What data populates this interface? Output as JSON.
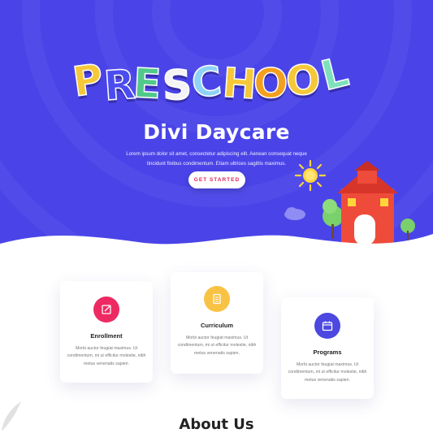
{
  "hero": {
    "logo_letters": [
      "P",
      "R",
      "E",
      "S",
      "C",
      "H",
      "O",
      "O",
      "L"
    ],
    "title": "Divi Daycare",
    "description": "Lorem ipsum dolor sit amet, consectetur adipiscing elit. Aenean consequat neque tincidunt finibus condimentum. Etiam ultrices sagittis maximus.",
    "cta_label": "GET STARTED"
  },
  "features": [
    {
      "title": "Enrollment",
      "text": "Morbi auctor feugiat maximus. Ut condimentum, mi ut efficitur molestie, nibh metus venenatis sapien.",
      "icon": "edit-icon",
      "color": "#ee2a62"
    },
    {
      "title": "Curriculum",
      "text": "Morbi auctor feugiat maximus. Ut condimentum, mi ut efficitur molestie, nibh metus venenatis sapien.",
      "icon": "document-icon",
      "color": "#f8c244"
    },
    {
      "title": "Programs",
      "text": "Morbi auctor feugiat maximus. Ut condimentum, mi ut efficitur molestie, nibh metus venenatis sapien.",
      "icon": "calendar-icon",
      "color": "#4c48e0"
    }
  ],
  "about": {
    "title": "About Us"
  },
  "colors": {
    "hero_bg": "#4a44e8",
    "accent_pink": "#e2245b"
  }
}
